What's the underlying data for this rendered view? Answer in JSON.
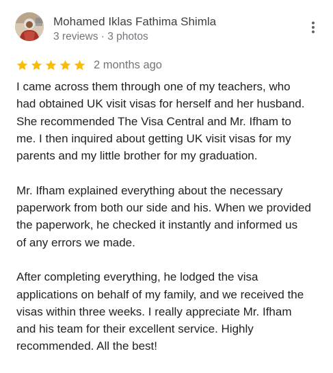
{
  "review": {
    "reviewer": {
      "name": "Mohamed Iklas Fathima Shimla",
      "meta": "3 reviews · 3 photos"
    },
    "rating": {
      "stars": 5,
      "max": 5,
      "star_color": "#fbbc04",
      "date": "2 months ago"
    },
    "more_icon": "more-vertical-icon",
    "paragraphs": [
      {
        "lines": [
          "I came across them through one of my teachers, who",
          "had obtained UK visit visas for herself and her husband.",
          "She recommended The Visa Central and Mr. Ifham to",
          "me. I then inquired about getting UK visit visas for my",
          "parents and my little brother for my graduation."
        ]
      },
      {
        "lines": [
          "Mr. Ifham explained everything about the necessary",
          "paperwork from both our side and his. When we provided",
          "the paperwork, he checked it instantly and informed us",
          "of any errors we made."
        ]
      },
      {
        "lines": [
          "After completing everything, he lodged the visa",
          "applications on behalf of my family, and we received the",
          "visas within three weeks. I really appreciate Mr. Ifham",
          "and his team for their excellent service. Highly",
          "recommended. All the best!"
        ]
      }
    ]
  }
}
